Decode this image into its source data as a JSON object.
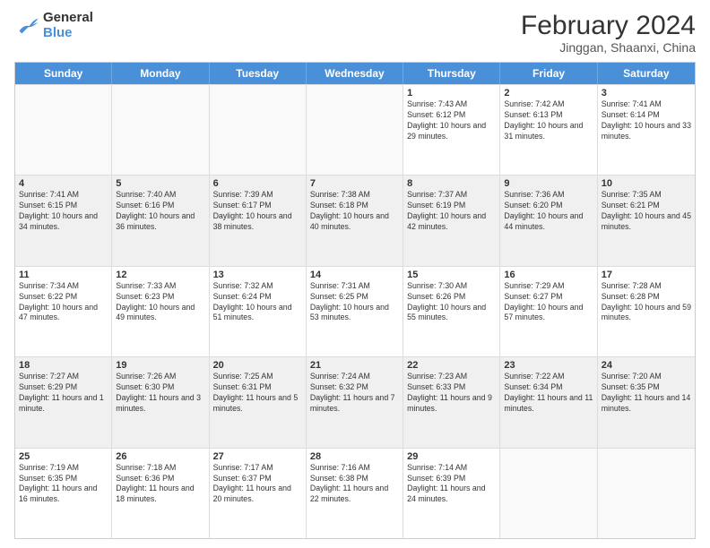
{
  "logo": {
    "text_general": "General",
    "text_blue": "Blue"
  },
  "header": {
    "month_year": "February 2024",
    "location": "Jinggan, Shaanxi, China"
  },
  "days_of_week": [
    "Sunday",
    "Monday",
    "Tuesday",
    "Wednesday",
    "Thursday",
    "Friday",
    "Saturday"
  ],
  "rows": [
    [
      {
        "day": "",
        "info": ""
      },
      {
        "day": "",
        "info": ""
      },
      {
        "day": "",
        "info": ""
      },
      {
        "day": "",
        "info": ""
      },
      {
        "day": "1",
        "info": "Sunrise: 7:43 AM\nSunset: 6:12 PM\nDaylight: 10 hours and 29 minutes."
      },
      {
        "day": "2",
        "info": "Sunrise: 7:42 AM\nSunset: 6:13 PM\nDaylight: 10 hours and 31 minutes."
      },
      {
        "day": "3",
        "info": "Sunrise: 7:41 AM\nSunset: 6:14 PM\nDaylight: 10 hours and 33 minutes."
      }
    ],
    [
      {
        "day": "4",
        "info": "Sunrise: 7:41 AM\nSunset: 6:15 PM\nDaylight: 10 hours and 34 minutes."
      },
      {
        "day": "5",
        "info": "Sunrise: 7:40 AM\nSunset: 6:16 PM\nDaylight: 10 hours and 36 minutes."
      },
      {
        "day": "6",
        "info": "Sunrise: 7:39 AM\nSunset: 6:17 PM\nDaylight: 10 hours and 38 minutes."
      },
      {
        "day": "7",
        "info": "Sunrise: 7:38 AM\nSunset: 6:18 PM\nDaylight: 10 hours and 40 minutes."
      },
      {
        "day": "8",
        "info": "Sunrise: 7:37 AM\nSunset: 6:19 PM\nDaylight: 10 hours and 42 minutes."
      },
      {
        "day": "9",
        "info": "Sunrise: 7:36 AM\nSunset: 6:20 PM\nDaylight: 10 hours and 44 minutes."
      },
      {
        "day": "10",
        "info": "Sunrise: 7:35 AM\nSunset: 6:21 PM\nDaylight: 10 hours and 45 minutes."
      }
    ],
    [
      {
        "day": "11",
        "info": "Sunrise: 7:34 AM\nSunset: 6:22 PM\nDaylight: 10 hours and 47 minutes."
      },
      {
        "day": "12",
        "info": "Sunrise: 7:33 AM\nSunset: 6:23 PM\nDaylight: 10 hours and 49 minutes."
      },
      {
        "day": "13",
        "info": "Sunrise: 7:32 AM\nSunset: 6:24 PM\nDaylight: 10 hours and 51 minutes."
      },
      {
        "day": "14",
        "info": "Sunrise: 7:31 AM\nSunset: 6:25 PM\nDaylight: 10 hours and 53 minutes."
      },
      {
        "day": "15",
        "info": "Sunrise: 7:30 AM\nSunset: 6:26 PM\nDaylight: 10 hours and 55 minutes."
      },
      {
        "day": "16",
        "info": "Sunrise: 7:29 AM\nSunset: 6:27 PM\nDaylight: 10 hours and 57 minutes."
      },
      {
        "day": "17",
        "info": "Sunrise: 7:28 AM\nSunset: 6:28 PM\nDaylight: 10 hours and 59 minutes."
      }
    ],
    [
      {
        "day": "18",
        "info": "Sunrise: 7:27 AM\nSunset: 6:29 PM\nDaylight: 11 hours and 1 minute."
      },
      {
        "day": "19",
        "info": "Sunrise: 7:26 AM\nSunset: 6:30 PM\nDaylight: 11 hours and 3 minutes."
      },
      {
        "day": "20",
        "info": "Sunrise: 7:25 AM\nSunset: 6:31 PM\nDaylight: 11 hours and 5 minutes."
      },
      {
        "day": "21",
        "info": "Sunrise: 7:24 AM\nSunset: 6:32 PM\nDaylight: 11 hours and 7 minutes."
      },
      {
        "day": "22",
        "info": "Sunrise: 7:23 AM\nSunset: 6:33 PM\nDaylight: 11 hours and 9 minutes."
      },
      {
        "day": "23",
        "info": "Sunrise: 7:22 AM\nSunset: 6:34 PM\nDaylight: 11 hours and 11 minutes."
      },
      {
        "day": "24",
        "info": "Sunrise: 7:20 AM\nSunset: 6:35 PM\nDaylight: 11 hours and 14 minutes."
      }
    ],
    [
      {
        "day": "25",
        "info": "Sunrise: 7:19 AM\nSunset: 6:35 PM\nDaylight: 11 hours and 16 minutes."
      },
      {
        "day": "26",
        "info": "Sunrise: 7:18 AM\nSunset: 6:36 PM\nDaylight: 11 hours and 18 minutes."
      },
      {
        "day": "27",
        "info": "Sunrise: 7:17 AM\nSunset: 6:37 PM\nDaylight: 11 hours and 20 minutes."
      },
      {
        "day": "28",
        "info": "Sunrise: 7:16 AM\nSunset: 6:38 PM\nDaylight: 11 hours and 22 minutes."
      },
      {
        "day": "29",
        "info": "Sunrise: 7:14 AM\nSunset: 6:39 PM\nDaylight: 11 hours and 24 minutes."
      },
      {
        "day": "",
        "info": ""
      },
      {
        "day": "",
        "info": ""
      }
    ]
  ]
}
